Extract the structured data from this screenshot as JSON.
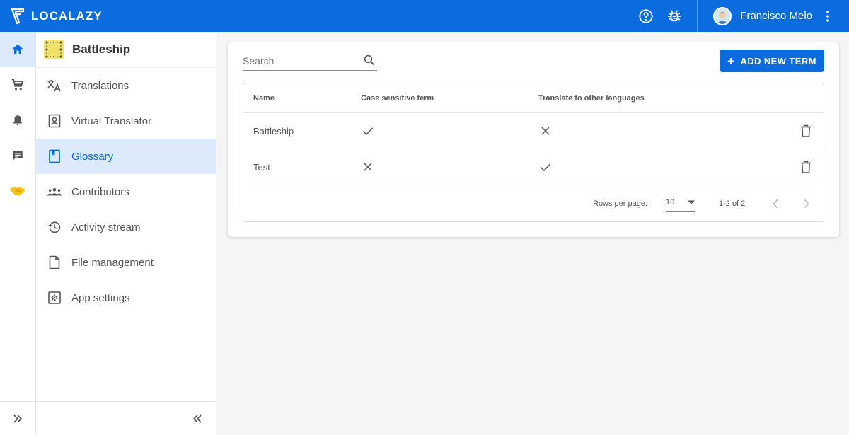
{
  "app": {
    "brand": "LOCALAZY"
  },
  "user": {
    "name": "Francisco Melo"
  },
  "colors": {
    "primary": "#0b6ce0",
    "active_bg": "#dceafb",
    "project_logo": "#f1e26a"
  },
  "rail": {
    "items": [
      {
        "icon": "home-icon",
        "active": true
      },
      {
        "icon": "cart-icon",
        "active": false
      },
      {
        "icon": "bell-icon",
        "active": false
      },
      {
        "icon": "chat-icon",
        "active": false
      },
      {
        "icon": "handshake-icon",
        "active": false
      }
    ]
  },
  "project": {
    "name": "Battleship"
  },
  "nav": {
    "items": [
      {
        "label": "Translations",
        "icon": "translate-icon"
      },
      {
        "label": "Virtual Translator",
        "icon": "virtual-translator-icon"
      },
      {
        "label": "Glossary",
        "icon": "book-icon",
        "active": true
      },
      {
        "label": "Contributors",
        "icon": "people-icon"
      },
      {
        "label": "Activity stream",
        "icon": "history-icon"
      },
      {
        "label": "File management",
        "icon": "file-icon"
      },
      {
        "label": "App settings",
        "icon": "settings-icon"
      }
    ]
  },
  "glossary": {
    "search_placeholder": "Search",
    "add_button": "ADD NEW TERM",
    "columns": [
      "Name",
      "Case sensitive term",
      "Translate to other languages"
    ],
    "rows": [
      {
        "name": "Battleship",
        "case_sensitive": true,
        "translate": false
      },
      {
        "name": "Test",
        "case_sensitive": false,
        "translate": true
      }
    ],
    "rows_per_page_label": "Rows per page:",
    "rows_per_page": "10",
    "range": "1-2 of 2"
  }
}
